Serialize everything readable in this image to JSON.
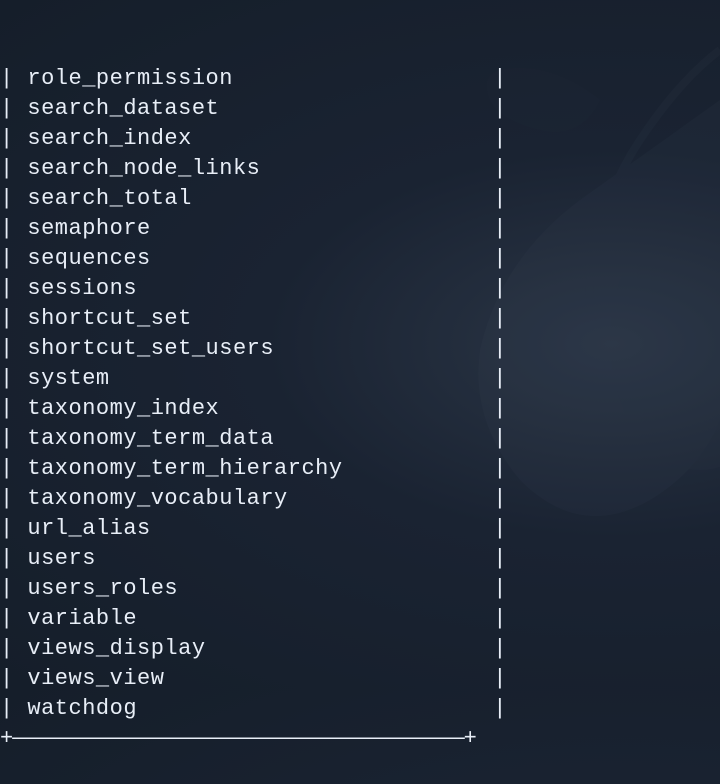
{
  "terminal": {
    "border_sep": "+—————————————————————————————————————+",
    "tables": [
      "role_permission",
      "search_dataset",
      "search_index",
      "search_node_links",
      "search_total",
      "semaphore",
      "sequences",
      "sessions",
      "shortcut_set",
      "shortcut_set_users",
      "system",
      "taxonomy_index",
      "taxonomy_term_data",
      "taxonomy_term_hierarchy",
      "taxonomy_vocabulary",
      "url_alias",
      "users",
      "users_roles",
      "variable",
      "views_display",
      "views_view",
      "watchdog"
    ]
  }
}
